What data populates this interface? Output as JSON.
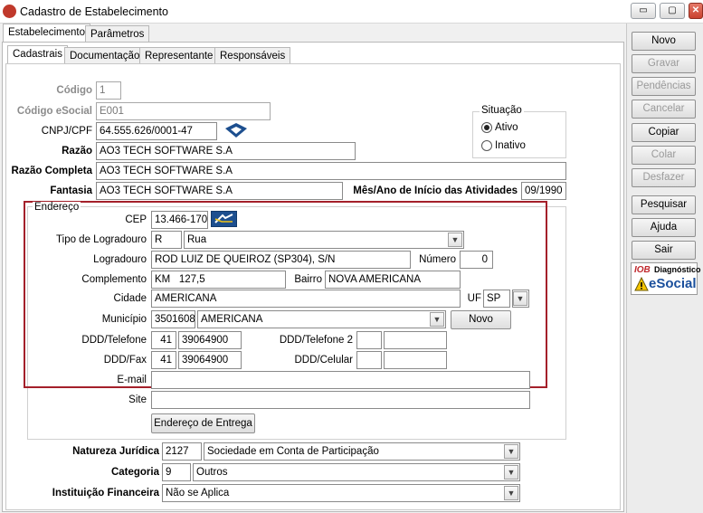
{
  "window": {
    "title": "Cadastro de Estabelecimento",
    "controls": [
      "▭",
      "▢",
      "✕"
    ]
  },
  "tabs": [
    "Estabelecimento",
    "Parâmetros"
  ],
  "subtabs": [
    "Cadastrais",
    "Documentação",
    "Representante",
    "Responsáveis"
  ],
  "form": {
    "codigo_label": "Código",
    "codigo": "1",
    "codigo_esocial_label": "Código eSocial",
    "codigo_esocial": "E001",
    "cnpj_label": "CNPJ/CPF",
    "cnpj": "64.555.626/0001-47",
    "razao_label": "Razão",
    "razao": "AO3 TECH SOFTWARE S.A",
    "razao_completa_label": "Razão Completa",
    "razao_completa": "AO3 TECH SOFTWARE S.A",
    "fantasia_label": "Fantasia",
    "fantasia": "AO3 TECH SOFTWARE S.A",
    "inicio_label": "Mês/Ano de Início das Atividades",
    "inicio": "09/1990",
    "situacao": {
      "title": "Situação",
      "ativo": "Ativo",
      "inativo": "Inativo",
      "selected": "Ativo"
    }
  },
  "endereco": {
    "title": "Endereço",
    "cep_label": "CEP",
    "cep": "13.466-170",
    "tipo_label": "Tipo de Logradouro",
    "tipo_code": "R",
    "tipo": "Rua",
    "logradouro_label": "Logradouro",
    "logradouro": "ROD LUIZ DE QUEIROZ (SP304), S/N",
    "numero_label": "Número",
    "numero": "0",
    "complemento_label": "Complemento",
    "complemento": "KM   127,5",
    "bairro_label": "Bairro",
    "bairro": "NOVA AMERICANA",
    "cidade_label": "Cidade",
    "cidade": "AMERICANA",
    "uf_label": "UF",
    "uf": "SP",
    "municipio_label": "Município",
    "municipio_code": "3501608",
    "municipio": "AMERICANA",
    "novo_button": "Novo",
    "ddd_tel_label": "DDD/Telefone",
    "ddd_tel": "41",
    "tel": "39064900",
    "ddd_tel2_label": "DDD/Telefone 2",
    "ddd_tel2": "",
    "tel2": "",
    "ddd_fax_label": "DDD/Fax",
    "ddd_fax": "41",
    "fax": "39064900",
    "ddd_cel_label": "DDD/Celular",
    "ddd_cel": "",
    "cel": "",
    "email_label": "E-mail",
    "email": "",
    "site_label": "Site",
    "site": "",
    "entrega_button": "Endereço de Entrega"
  },
  "bottom": {
    "natureza_label": "Natureza Jurídica",
    "natureza_code": "2127",
    "natureza": "Sociedade em Conta de Participação",
    "categoria_label": "Categoria",
    "categoria_code": "9",
    "categoria": "Outros",
    "instituicao_label": "Instituição Financeira",
    "instituicao": "Não se Aplica"
  },
  "sidebar": {
    "buttons": [
      {
        "label": "Novo",
        "enabled": true
      },
      {
        "label": "Gravar",
        "enabled": false
      },
      {
        "label": "Pendências",
        "enabled": false
      },
      {
        "label": "Cancelar",
        "enabled": false
      },
      {
        "label": "Copiar",
        "enabled": true
      },
      {
        "label": "Colar",
        "enabled": false
      },
      {
        "label": "Desfazer",
        "enabled": false
      },
      {
        "label": "Pesquisar",
        "enabled": true
      },
      {
        "label": "Ajuda",
        "enabled": true
      },
      {
        "label": "Sair",
        "enabled": true
      }
    ],
    "iob_brand": "IOB",
    "iob_title": "Diagnóstico",
    "iob_subtitle": "eSocial"
  },
  "colors": {
    "highlight": "#a4202a",
    "iob_blue": "#1a4f9c",
    "iob_green": "#3a9a3a"
  }
}
